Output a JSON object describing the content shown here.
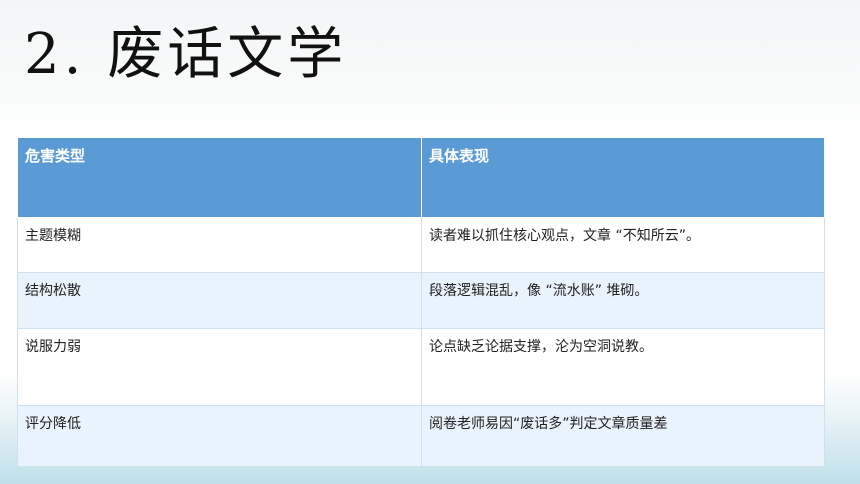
{
  "slide": {
    "title": "2. 废话文学"
  },
  "table": {
    "headers": [
      "危害类型",
      "具体表现"
    ],
    "rows": [
      [
        "主题模糊",
        "读者难以抓住核心观点，文章 “不知所云”。"
      ],
      [
        "结构松散",
        "段落逻辑混乱，像 “流水账” 堆砌。"
      ],
      [
        "说服力弱",
        "论点缺乏论据支撑，沦为空洞说教。"
      ],
      [
        "评分降低",
        "阅卷老师易因“废话多”判定文章质量差"
      ]
    ]
  },
  "colors": {
    "header_bg": "#5b9bd5",
    "header_text": "#ffffff",
    "row_alt_bg": "#e9f3fb",
    "row_bg": "#ffffff",
    "title_text": "#111111"
  }
}
